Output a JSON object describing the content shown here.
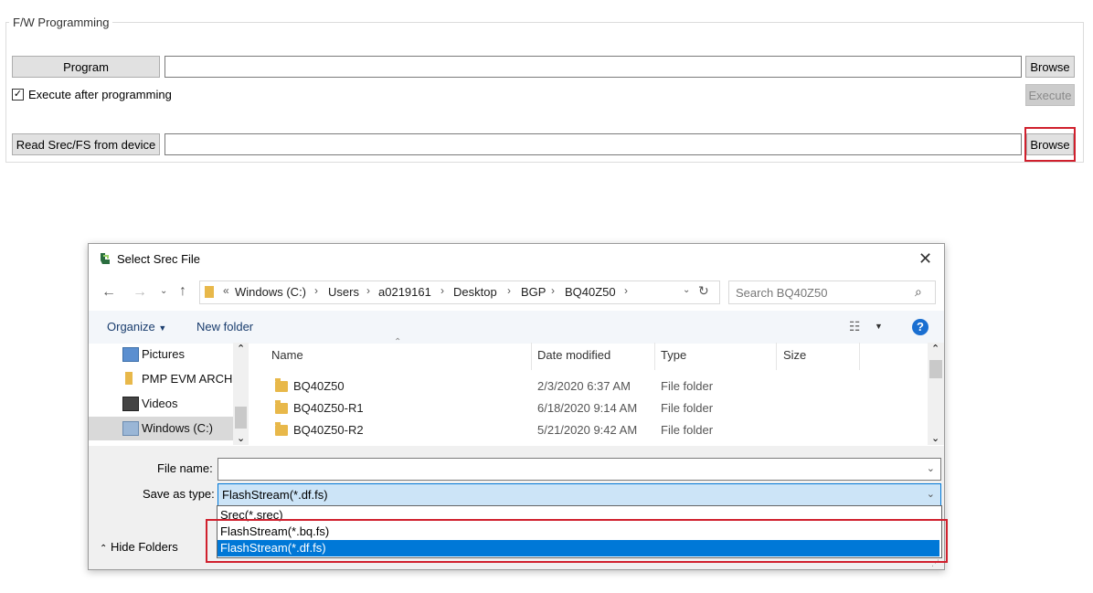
{
  "fw": {
    "group_title": "F/W Programming",
    "program_label": "Program",
    "program_path": "",
    "browse_label": "Browse",
    "execute_checkbox_label": "Execute after programming",
    "execute_checked": true,
    "execute_label": "Execute",
    "read_label": "Read Srec/FS from device",
    "read_path": "",
    "browse2_label": "Browse"
  },
  "dialog": {
    "title": "Select Srec File",
    "breadcrumb": [
      "Windows (C:)",
      "Users",
      "a0219161",
      "Desktop",
      "BGP",
      "BQ40Z50"
    ],
    "breadcrumb_prefix": "«",
    "search_placeholder": "Search BQ40Z50",
    "organize_label": "Organize",
    "new_folder_label": "New folder",
    "nav_items": [
      "Pictures",
      "PMP EVM ARCHI",
      "Videos",
      "Windows (C:)"
    ],
    "columns": [
      "Name",
      "Date modified",
      "Type",
      "Size"
    ],
    "files": [
      {
        "name": "BQ40Z50",
        "date": "2/3/2020 6:37 AM",
        "type": "File folder"
      },
      {
        "name": "BQ40Z50-R1",
        "date": "6/18/2020 9:14 AM",
        "type": "File folder"
      },
      {
        "name": "BQ40Z50-R2",
        "date": "5/21/2020 9:42 AM",
        "type": "File folder"
      }
    ],
    "file_name_label": "File name:",
    "file_name_value": "",
    "save_type_label": "Save as type:",
    "save_type_value": "FlashStream(*.df.fs)",
    "type_options": [
      "Srec(*.srec)",
      "FlashStream(*.bq.fs)",
      "FlashStream(*.df.fs)"
    ],
    "hide_folders_label": "Hide Folders"
  },
  "colors": {
    "highlight_red": "#d0202d",
    "selection_blue": "#0078d7",
    "folder_yellow": "#e8b84a"
  }
}
